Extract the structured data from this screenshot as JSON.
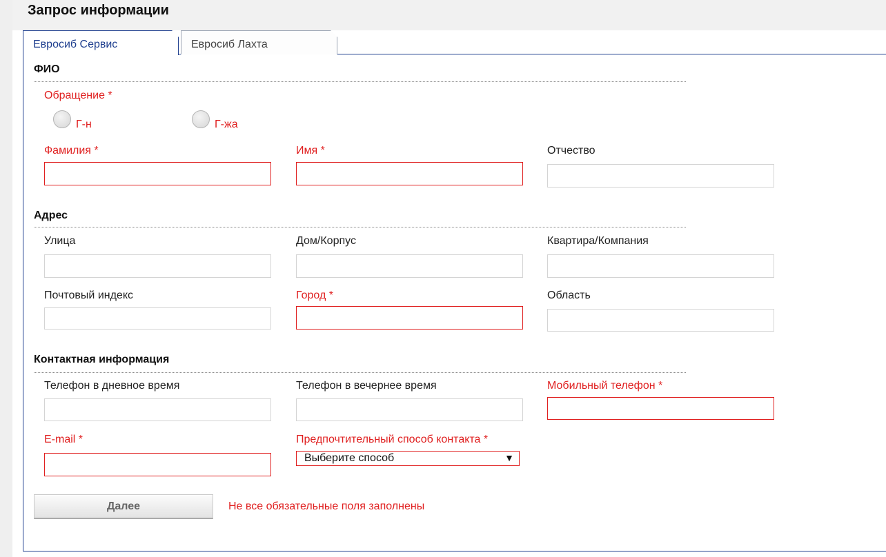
{
  "header": {
    "title": "Запрос информации"
  },
  "tabs": [
    {
      "label": "Евросиб Сервис",
      "active": true
    },
    {
      "label": "Евросиб Лахта",
      "active": false
    }
  ],
  "sections": {
    "fio": "ФИО",
    "address": "Адрес",
    "contact": "Контактная информация"
  },
  "fields": {
    "salutation": {
      "label": "Обращение *",
      "options": [
        "Г-н",
        "Г-жа"
      ]
    },
    "last_name": {
      "label": "Фамилия *",
      "value": ""
    },
    "first_name": {
      "label": "Имя *",
      "value": ""
    },
    "patronymic": {
      "label": "Отчество",
      "value": ""
    },
    "street": {
      "label": "Улица",
      "value": ""
    },
    "house": {
      "label": "Дом/Корпус",
      "value": ""
    },
    "apartment": {
      "label": "Квартира/Компания",
      "value": ""
    },
    "postal_code": {
      "label": "Почтовый индекс",
      "value": ""
    },
    "city": {
      "label": "Город *",
      "value": ""
    },
    "region": {
      "label": "Область",
      "value": ""
    },
    "day_phone": {
      "label": "Телефон в дневное время",
      "value": ""
    },
    "evening_phone": {
      "label": "Телефон в вечернее время",
      "value": ""
    },
    "mobile_phone": {
      "label": "Мобильный телефон *",
      "value": ""
    },
    "email": {
      "label": "E-mail *",
      "value": ""
    },
    "contact_method": {
      "label": "Предпочтительный способ контакта *",
      "selected": "Выберите способ"
    }
  },
  "actions": {
    "next_label": "Далее"
  },
  "validation": {
    "message": "Не все обязательные поля заполнены"
  },
  "colors": {
    "required": "#e02020",
    "accent": "#1f3f8f"
  },
  "icons": {
    "dropdown": "chevron-down-icon"
  }
}
